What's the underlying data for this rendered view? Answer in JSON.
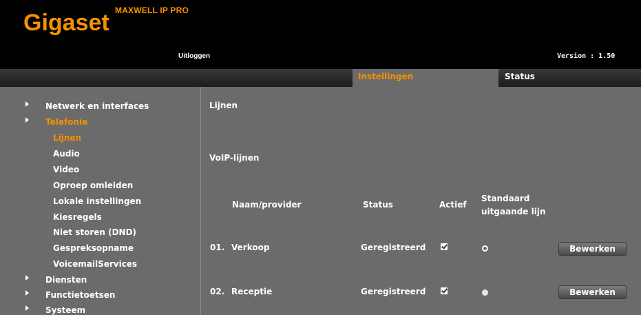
{
  "header": {
    "brand": "Gigaset",
    "product": "MAXWELL IP PRO",
    "logout": "Uitloggen",
    "version": "Version : 1.50"
  },
  "tabs": {
    "settings": "Instellingen",
    "status": "Status"
  },
  "sidebar": {
    "items": [
      {
        "label": "Netwerk en interfaces"
      },
      {
        "label": "Telefonie"
      },
      {
        "label": "Lijnen"
      },
      {
        "label": "Audio"
      },
      {
        "label": "Video"
      },
      {
        "label": "Oproep omleiden"
      },
      {
        "label": "Lokale instellingen"
      },
      {
        "label": "Kiesregels"
      },
      {
        "label": "Niet storen (DND)"
      },
      {
        "label": "Gespreksopname"
      },
      {
        "label": "VoicemailServices"
      },
      {
        "label": "Diensten"
      },
      {
        "label": "Functietoetsen"
      },
      {
        "label": "Systeem"
      }
    ]
  },
  "main": {
    "title": "Lijnen",
    "section": "VoIP-lijnen",
    "columns": {
      "name": "Naam/provider",
      "status": "Status",
      "active": "Actief",
      "default_line": "Standaard\nuitgaande lijn"
    },
    "rows": [
      {
        "number": "01.",
        "name": "Verkoop",
        "status": "Geregistreerd",
        "active": true,
        "default_selected": false,
        "action": "Bewerken"
      },
      {
        "number": "02.",
        "name": "Receptie",
        "status": "Geregistreerd",
        "active": true,
        "default_selected": true,
        "action": "Bewerken"
      }
    ]
  },
  "colors": {
    "accent": "#f39200",
    "background": "#6b6b6b",
    "header_bg": "#000000"
  }
}
